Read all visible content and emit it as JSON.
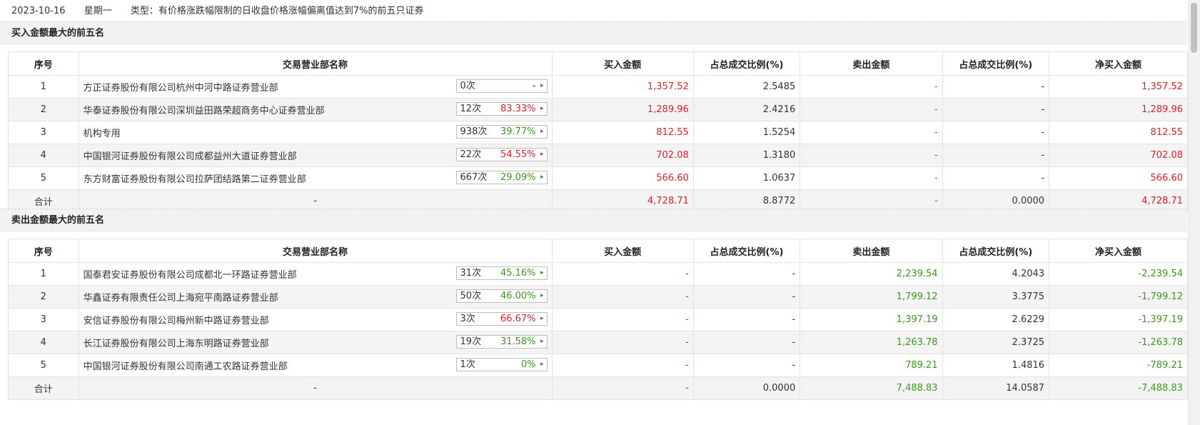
{
  "header": {
    "date": "2023-10-16",
    "weekday": "星期一",
    "type_label": "类型：有价格涨跌幅限制的日收盘价格涨幅偏离值达到7%的前五只证券"
  },
  "columns": [
    "序号",
    "交易营业部名称",
    "买入金额",
    "占总成交比例(%)",
    "卖出金额",
    "占总成交比例(%)",
    "净买入金额"
  ],
  "buy_section": {
    "title": "买入金额最大的前五名",
    "rows": [
      {
        "no": "1",
        "name": "方正证券股份有限公司杭州中河中路证券营业部",
        "times": "0次",
        "rate": "-",
        "rate_color": "plain",
        "buy": "1,357.52",
        "buy_pct": "2.5485",
        "sell": "-",
        "sell_pct": "-",
        "net": "1,357.52"
      },
      {
        "no": "2",
        "name": "华泰证券股份有限公司深圳益田路荣超商务中心证券营业部",
        "times": "12次",
        "rate": "83.33%",
        "rate_color": "red",
        "buy": "1,289.96",
        "buy_pct": "2.4216",
        "sell": "-",
        "sell_pct": "-",
        "net": "1,289.96"
      },
      {
        "no": "3",
        "name": "机构专用",
        "times": "938次",
        "rate": "39.77%",
        "rate_color": "green",
        "buy": "812.55",
        "buy_pct": "1.5254",
        "sell": "-",
        "sell_pct": "-",
        "net": "812.55"
      },
      {
        "no": "4",
        "name": "中国银河证券股份有限公司成都益州大道证券营业部",
        "times": "22次",
        "rate": "54.55%",
        "rate_color": "red",
        "buy": "702.08",
        "buy_pct": "1.3180",
        "sell": "-",
        "sell_pct": "-",
        "net": "702.08"
      },
      {
        "no": "5",
        "name": "东方财富证券股份有限公司拉萨团结路第二证券营业部",
        "times": "667次",
        "rate": "29.09%",
        "rate_color": "green",
        "buy": "566.60",
        "buy_pct": "1.0637",
        "sell": "-",
        "sell_pct": "-",
        "net": "566.60"
      }
    ],
    "total": {
      "label": "合计",
      "name": "-",
      "buy": "4,728.71",
      "buy_pct": "8.8772",
      "sell": "-",
      "sell_pct": "0.0000",
      "net": "4,728.71"
    }
  },
  "sell_section": {
    "title": "卖出金额最大的前五名",
    "rows": [
      {
        "no": "1",
        "name": "国泰君安证券股份有限公司成都北一环路证券营业部",
        "times": "31次",
        "rate": "45.16%",
        "rate_color": "green",
        "buy": "-",
        "buy_pct": "-",
        "sell": "2,239.54",
        "sell_pct": "4.2043",
        "net": "-2,239.54"
      },
      {
        "no": "2",
        "name": "华鑫证券有限责任公司上海宛平南路证券营业部",
        "times": "50次",
        "rate": "46.00%",
        "rate_color": "green",
        "buy": "-",
        "buy_pct": "-",
        "sell": "1,799.12",
        "sell_pct": "3.3775",
        "net": "-1,799.12"
      },
      {
        "no": "3",
        "name": "安信证券股份有限公司梅州新中路证券营业部",
        "times": "3次",
        "rate": "66.67%",
        "rate_color": "red",
        "buy": "-",
        "buy_pct": "-",
        "sell": "1,397.19",
        "sell_pct": "2.6229",
        "net": "-1,397.19"
      },
      {
        "no": "4",
        "name": "长江证券股份有限公司上海东明路证券营业部",
        "times": "19次",
        "rate": "31.58%",
        "rate_color": "green",
        "buy": "-",
        "buy_pct": "-",
        "sell": "1,263.78",
        "sell_pct": "2.3725",
        "net": "-1,263.78"
      },
      {
        "no": "5",
        "name": "中国银河证券股份有限公司南通工农路证券营业部",
        "times": "1次",
        "rate": "0%",
        "rate_color": "green",
        "buy": "-",
        "buy_pct": "-",
        "sell": "789.21",
        "sell_pct": "1.4816",
        "net": "-789.21"
      }
    ],
    "total": {
      "label": "合计",
      "name": "-",
      "buy": "-",
      "buy_pct": "0.0000",
      "sell": "7,488.83",
      "sell_pct": "14.0587",
      "net": "-7,488.83"
    }
  },
  "colors": {
    "up": "#e81e26",
    "down": "#3a9a1f"
  }
}
